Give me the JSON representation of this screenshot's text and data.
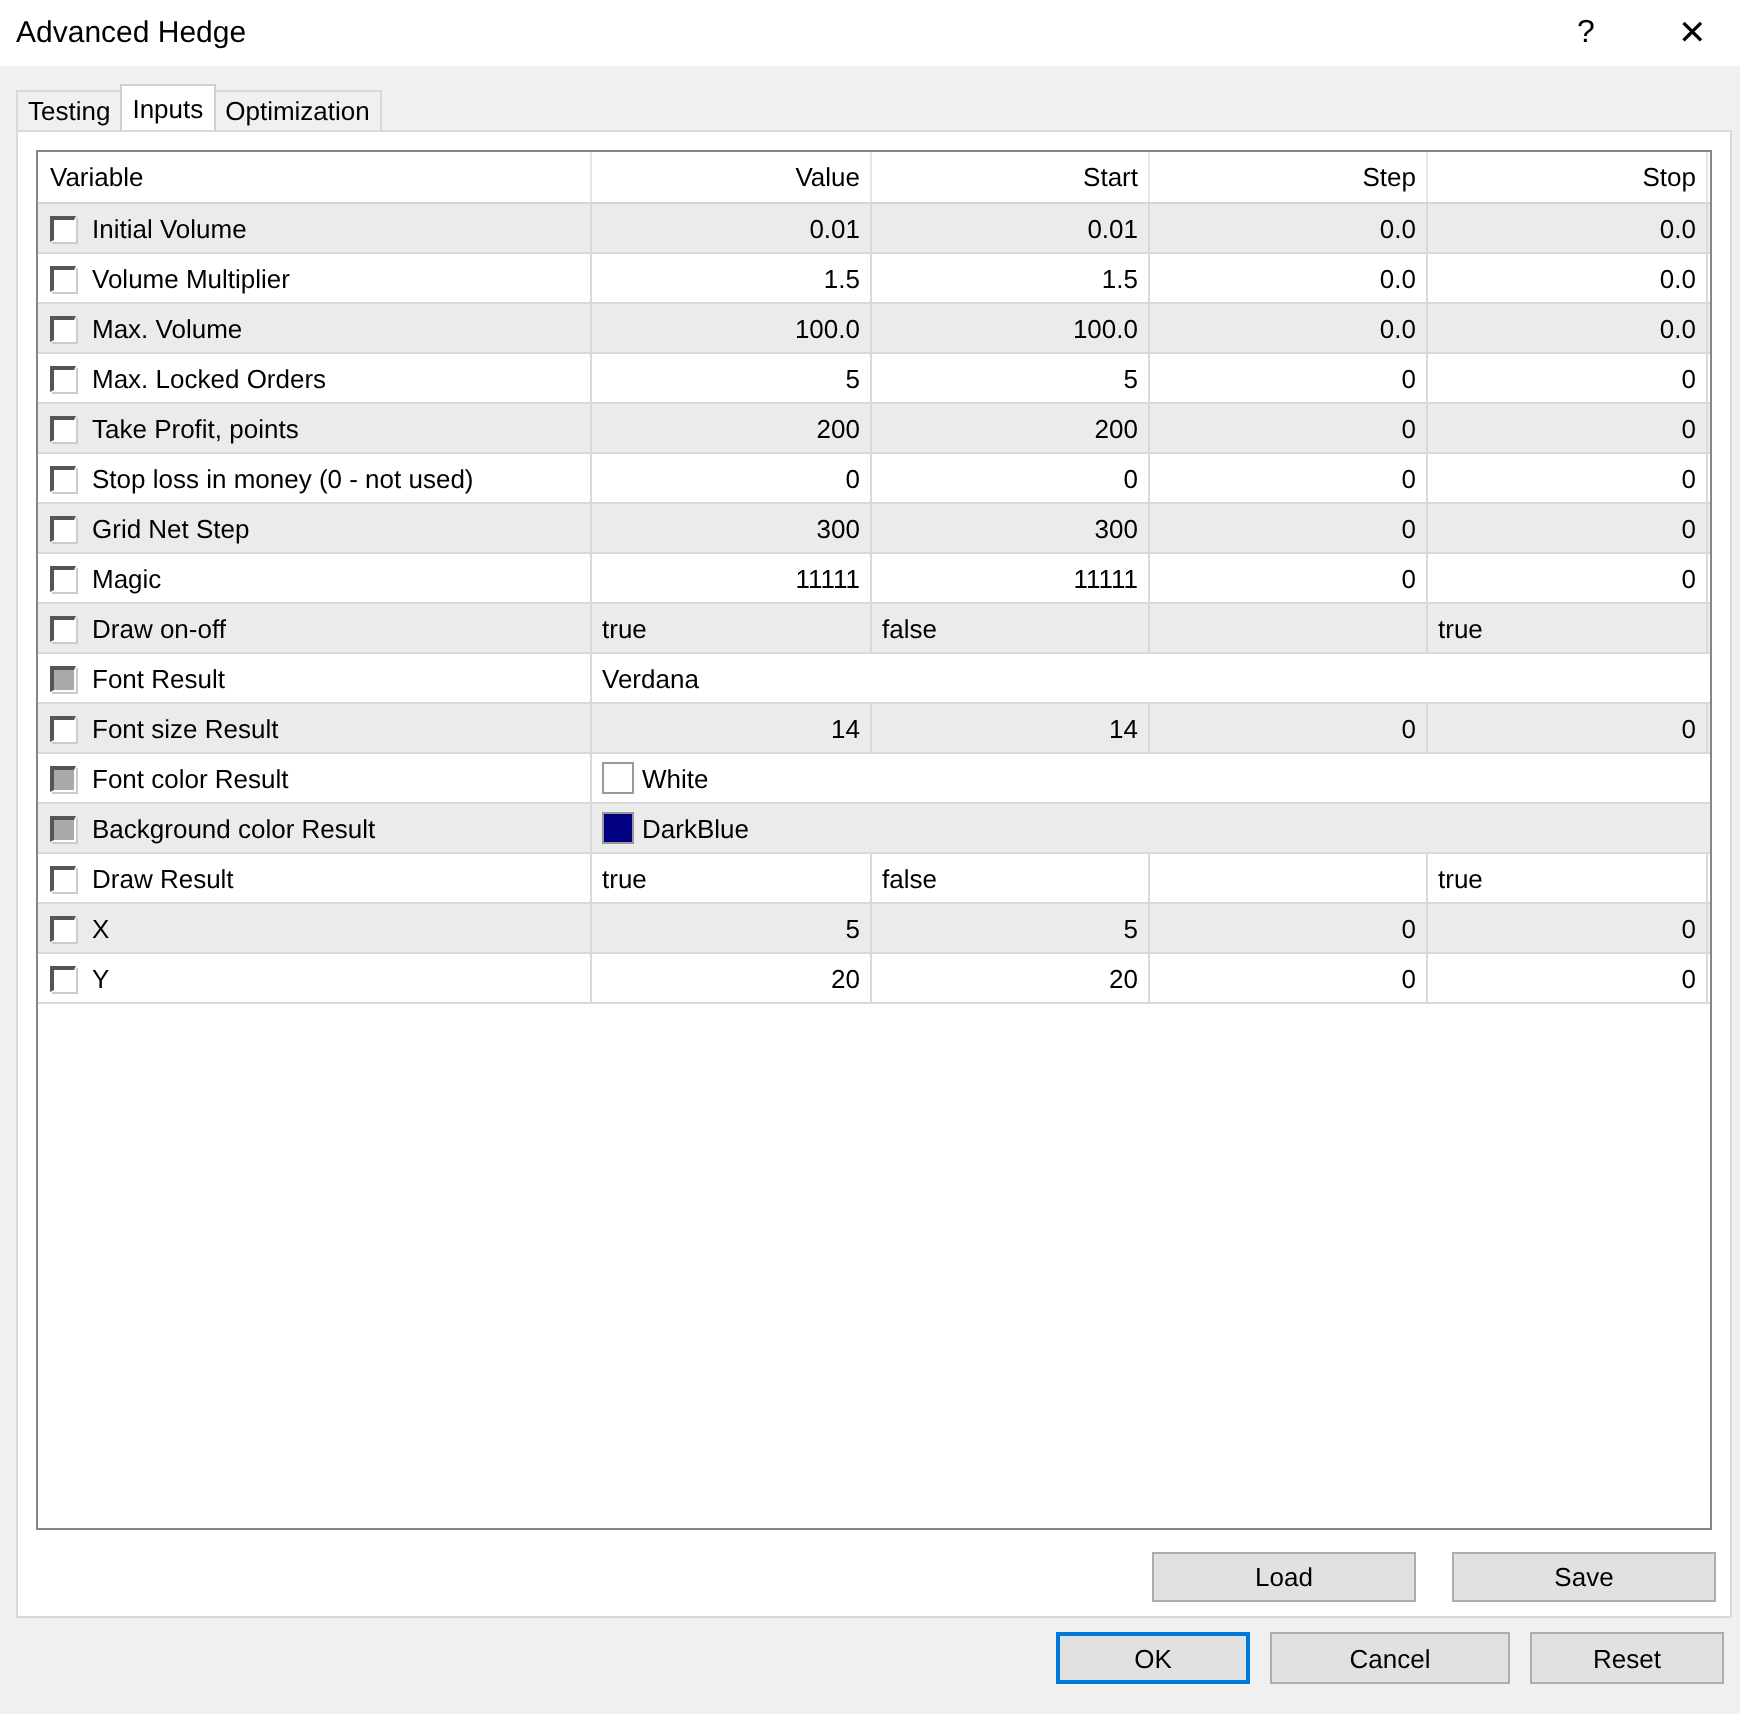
{
  "window": {
    "title": "Advanced Hedge",
    "help": "?",
    "close": "✕"
  },
  "tabs": [
    {
      "label": "Testing",
      "selected": false
    },
    {
      "label": "Inputs",
      "selected": true
    },
    {
      "label": "Optimization",
      "selected": false
    }
  ],
  "table": {
    "columns": [
      "Variable",
      "Value",
      "Start",
      "Step",
      "Stop"
    ],
    "rows": [
      {
        "kind": "number",
        "checked": false,
        "disabled": false,
        "cells": [
          "Initial Volume",
          "0.01",
          "0.01",
          "0.0",
          "0.0"
        ]
      },
      {
        "kind": "number",
        "checked": false,
        "disabled": false,
        "cells": [
          "Volume Multiplier",
          "1.5",
          "1.5",
          "0.0",
          "0.0"
        ]
      },
      {
        "kind": "number",
        "checked": false,
        "disabled": false,
        "cells": [
          "Max. Volume",
          "100.0",
          "100.0",
          "0.0",
          "0.0"
        ]
      },
      {
        "kind": "number",
        "checked": false,
        "disabled": false,
        "cells": [
          "Max. Locked Orders",
          "5",
          "5",
          "0",
          "0"
        ]
      },
      {
        "kind": "number",
        "checked": false,
        "disabled": false,
        "cells": [
          "Take Profit, points",
          "200",
          "200",
          "0",
          "0"
        ]
      },
      {
        "kind": "number",
        "checked": false,
        "disabled": false,
        "cells": [
          "Stop loss in money (0 - not used)",
          "0",
          "0",
          "0",
          "0"
        ]
      },
      {
        "kind": "number",
        "checked": false,
        "disabled": false,
        "cells": [
          "Grid Net Step",
          "300",
          "300",
          "0",
          "0"
        ]
      },
      {
        "kind": "number",
        "checked": false,
        "disabled": false,
        "cells": [
          "Magic",
          "11111",
          "11111",
          "0",
          "0"
        ]
      },
      {
        "kind": "bool",
        "checked": false,
        "disabled": false,
        "cells": [
          "Draw on-off",
          "true",
          "false",
          "",
          "true"
        ]
      },
      {
        "kind": "text",
        "checked": false,
        "disabled": true,
        "cells": [
          "Font Result",
          "Verdana"
        ]
      },
      {
        "kind": "number",
        "checked": false,
        "disabled": false,
        "cells": [
          "Font size Result",
          "14",
          "14",
          "0",
          "0"
        ]
      },
      {
        "kind": "color",
        "checked": false,
        "disabled": true,
        "color": "#ffffff",
        "cells": [
          "Font color Result",
          "White"
        ]
      },
      {
        "kind": "color",
        "checked": false,
        "disabled": true,
        "color": "#000080",
        "cells": [
          "Background color Result",
          "DarkBlue"
        ]
      },
      {
        "kind": "bool",
        "checked": false,
        "disabled": false,
        "cells": [
          "Draw Result",
          "true",
          "false",
          "",
          "true"
        ]
      },
      {
        "kind": "number",
        "checked": false,
        "disabled": false,
        "cells": [
          "X",
          "5",
          "5",
          "0",
          "0"
        ]
      },
      {
        "kind": "number",
        "checked": false,
        "disabled": false,
        "cells": [
          "Y",
          "20",
          "20",
          "0",
          "0"
        ]
      }
    ]
  },
  "panel_buttons": [
    "Load",
    "Save"
  ],
  "dialog_buttons": [
    {
      "label": "OK",
      "default": true
    },
    {
      "label": "Cancel",
      "default": false
    },
    {
      "label": "Reset",
      "default": false
    }
  ]
}
